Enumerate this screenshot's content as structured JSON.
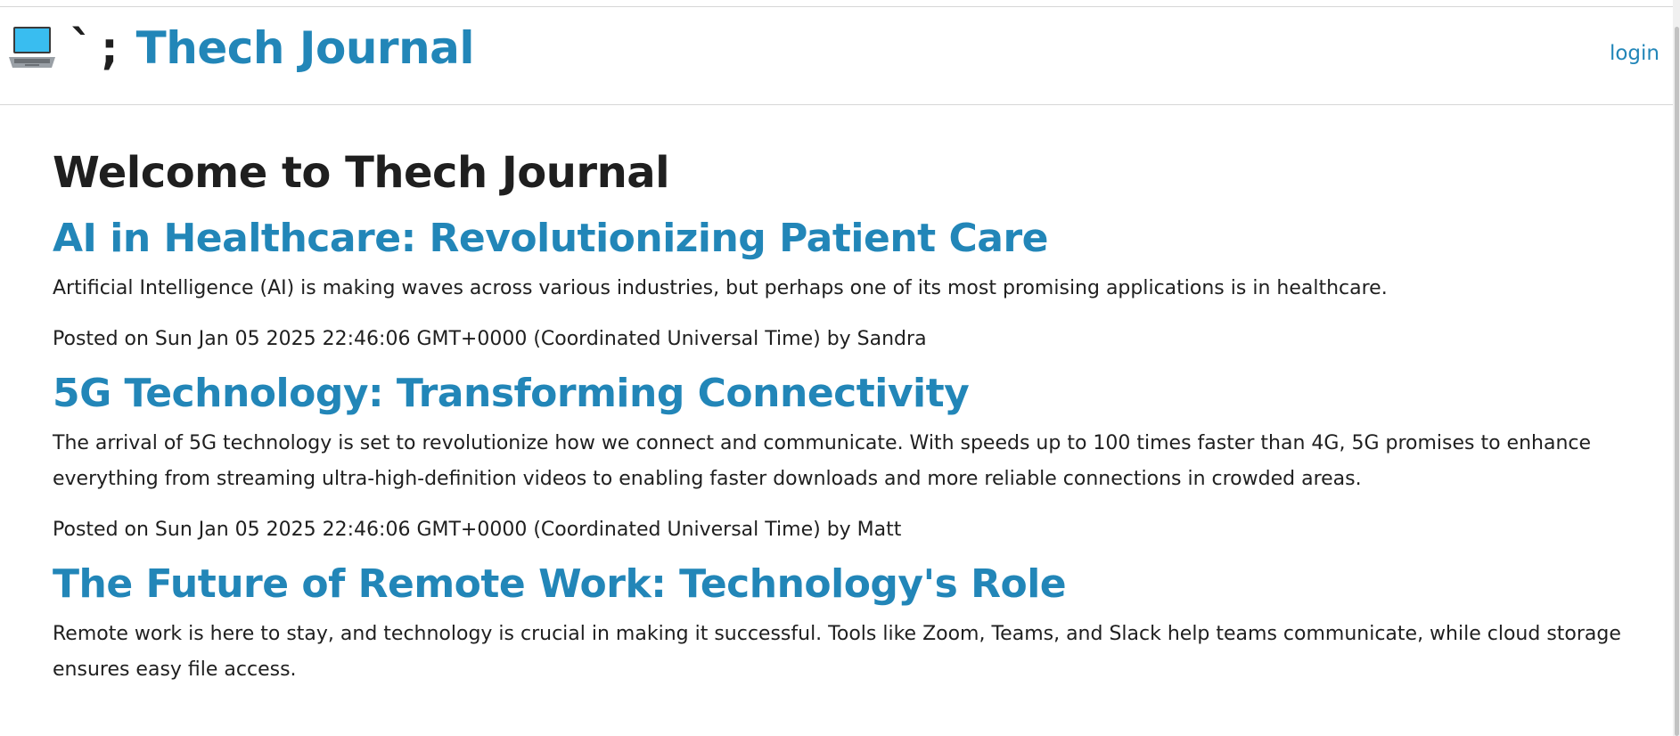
{
  "site": {
    "icon": "laptop-icon",
    "punct": "`;",
    "title": "Thech Journal",
    "brand_color": "#2286b8"
  },
  "nav": {
    "login_label": "login"
  },
  "main": {
    "heading": "Welcome to Thech Journal",
    "posts": [
      {
        "title": "AI in Healthcare: Revolutionizing Patient Care",
        "excerpt": "Artificial Intelligence (AI) is making waves across various industries, but perhaps one of its most promising applications is in healthcare.",
        "meta": "Posted on Sun Jan 05 2025 22:46:06 GMT+0000 (Coordinated Universal Time) by Sandra"
      },
      {
        "title": "5G Technology: Transforming Connectivity",
        "excerpt": "The arrival of 5G technology is set to revolutionize how we connect and communicate. With speeds up to 100 times faster than 4G, 5G promises to enhance everything from streaming ultra-high-definition videos to enabling faster downloads and more reliable connections in crowded areas.",
        "meta": "Posted on Sun Jan 05 2025 22:46:06 GMT+0000 (Coordinated Universal Time) by Matt"
      },
      {
        "title": "The Future of Remote Work: Technology's Role",
        "excerpt": "Remote work is here to stay, and technology is crucial in making it successful. Tools like Zoom, Teams, and Slack help teams communicate, while cloud storage ensures easy file access.",
        "meta": ""
      }
    ]
  }
}
